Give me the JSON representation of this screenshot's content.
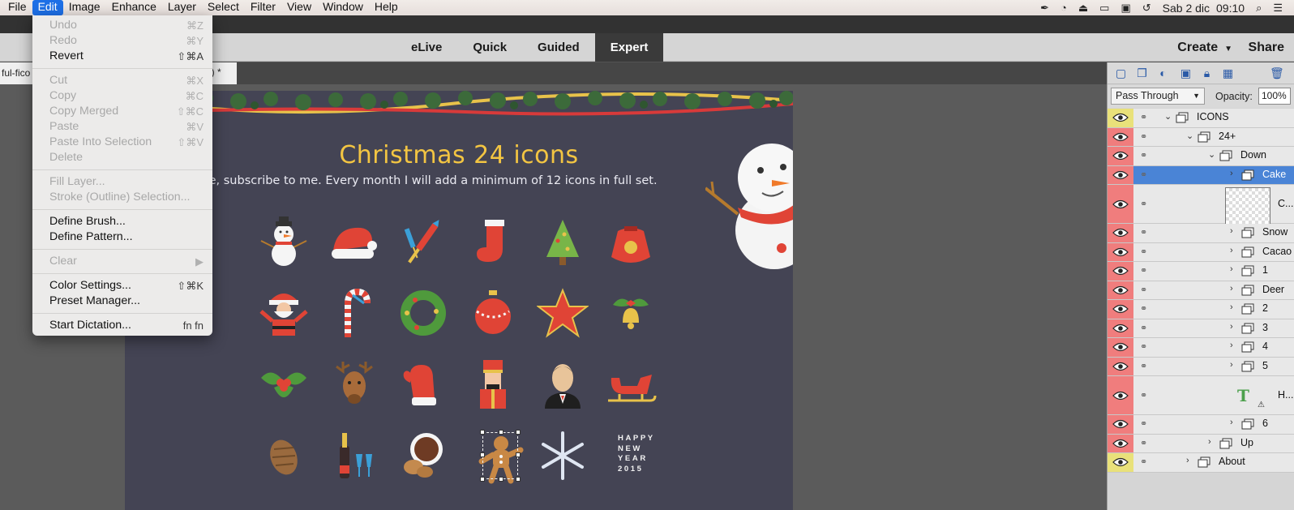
{
  "menubar": {
    "items": [
      "File",
      "Edit",
      "Image",
      "Enhance",
      "Layer",
      "Select",
      "Filter",
      "View",
      "Window",
      "Help"
    ],
    "active": "Edit",
    "date": "Sab 2 dic",
    "time": "09:10"
  },
  "modes": {
    "tabs": [
      "eLive",
      "Quick",
      "Guided",
      "Expert"
    ],
    "active": "Expert",
    "create": "Create",
    "share": "Share"
  },
  "document": {
    "tab_name": "ful-fico",
    "tab_suffix": "*) *"
  },
  "edit_menu": {
    "items": [
      {
        "label": "Undo",
        "shortcut": "⌘Z",
        "disabled": true
      },
      {
        "label": "Redo",
        "shortcut": "⌘Y",
        "disabled": true
      },
      {
        "label": "Revert",
        "shortcut": "⇧⌘A",
        "disabled": false
      },
      {
        "label": "Cut",
        "shortcut": "⌘X",
        "disabled": true
      },
      {
        "label": "Copy",
        "shortcut": "⌘C",
        "disabled": true
      },
      {
        "label": "Copy Merged",
        "shortcut": "⇧⌘C",
        "disabled": true
      },
      {
        "label": "Paste",
        "shortcut": "⌘V",
        "disabled": true
      },
      {
        "label": "Paste Into Selection",
        "shortcut": "⇧⌘V",
        "disabled": true
      },
      {
        "label": "Delete",
        "shortcut": "",
        "disabled": true
      },
      {
        "label": "Fill Layer...",
        "shortcut": "",
        "disabled": true
      },
      {
        "label": "Stroke (Outline) Selection...",
        "shortcut": "",
        "disabled": true
      },
      {
        "label": "Define Brush...",
        "shortcut": "",
        "disabled": false
      },
      {
        "label": "Define Pattern...",
        "shortcut": "",
        "disabled": false
      },
      {
        "label": "Clear",
        "shortcut": "▶",
        "disabled": true
      },
      {
        "label": "Color Settings...",
        "shortcut": "⇧⌘K",
        "disabled": false
      },
      {
        "label": "Preset Manager...",
        "shortcut": "",
        "disabled": false
      },
      {
        "label": "Start Dictation...",
        "shortcut": "fn fn",
        "disabled": false
      }
    ]
  },
  "artwork": {
    "title": "Christmas 24 icons",
    "subtitle": "If you like, subscribe to me. Every month I will add a minimum of 12 icons in full set.",
    "happy_lines": [
      "HAPPY",
      "NEW",
      "YEAR",
      "2015"
    ]
  },
  "layers_panel": {
    "blend_mode": "Pass Through",
    "opacity_label": "Opacity:",
    "opacity_value": "100%",
    "layers": [
      {
        "name": "ICONS"
      },
      {
        "name": "24+"
      },
      {
        "name": "Down"
      },
      {
        "name": "Cake"
      },
      {
        "name": "C..."
      },
      {
        "name": "Snow"
      },
      {
        "name": "Cacao"
      },
      {
        "name": "1"
      },
      {
        "name": "Deer"
      },
      {
        "name": "2"
      },
      {
        "name": "3"
      },
      {
        "name": "4"
      },
      {
        "name": "5"
      },
      {
        "name": "H..."
      },
      {
        "name": "6"
      },
      {
        "name": "Up"
      },
      {
        "name": "About"
      }
    ]
  }
}
